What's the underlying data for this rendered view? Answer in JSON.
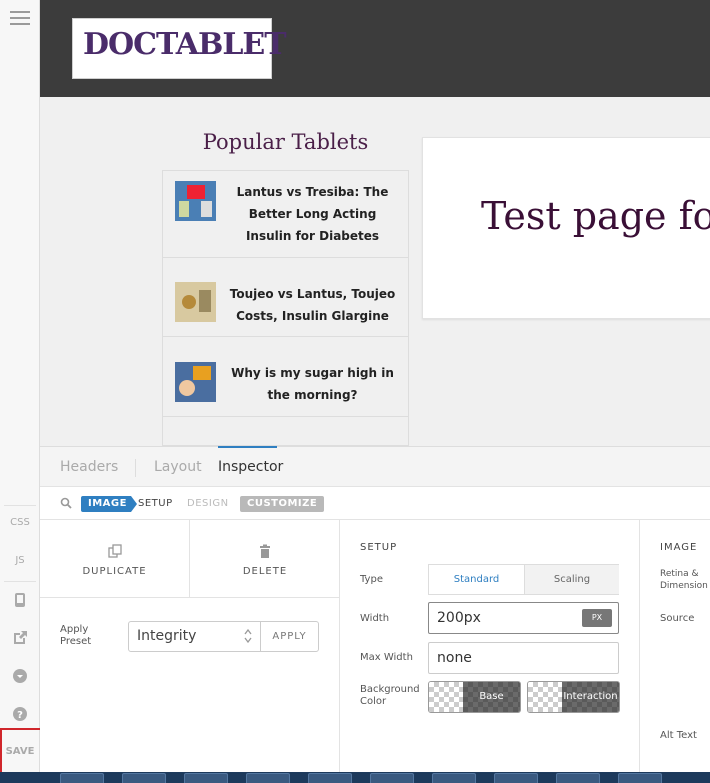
{
  "colors": {
    "accent": "#2f7fc1",
    "header_bg": "#3c3c3c",
    "save_highlight": "#d0262b"
  },
  "rail": {
    "css": "CSS",
    "js": "JS",
    "save": "SAVE"
  },
  "logo": {
    "text": "DOCTABLET"
  },
  "preview": {
    "popular_title": "Popular Tablets",
    "items": [
      {
        "title": "Lantus vs Tresiba: The Better Long Acting Insulin for Diabetes"
      },
      {
        "title": "Toujeo vs Lantus, Toujeo Costs, Insulin Glargine"
      },
      {
        "title": "Why is my sugar high in the morning?"
      }
    ],
    "card_title": "Test page for"
  },
  "panel": {
    "tabs": [
      "Headers",
      "Layout",
      "Inspector"
    ],
    "crumbs": {
      "image": "IMAGE",
      "setup": "SETUP",
      "design": "DESIGN",
      "customize": "CUSTOMIZE"
    },
    "actions": {
      "duplicate": "DUPLICATE",
      "delete": "DELETE"
    },
    "preset": {
      "label": "Apply Preset",
      "value": "Integrity",
      "apply": "APPLY"
    },
    "setup": {
      "heading": "SETUP",
      "type_label": "Type",
      "type_options": [
        "Standard",
        "Scaling"
      ],
      "type_selected": "Standard",
      "width_label": "Width",
      "width_value": "200px",
      "width_unit": "PX",
      "maxwidth_label": "Max Width",
      "maxwidth_value": "none",
      "bg_label": "Background Color",
      "bg_base": "Base",
      "bg_interaction": "Interaction"
    },
    "image": {
      "heading": "IMAGE",
      "retina": "Retina & Dimension",
      "source": "Source",
      "alt": "Alt Text"
    }
  }
}
